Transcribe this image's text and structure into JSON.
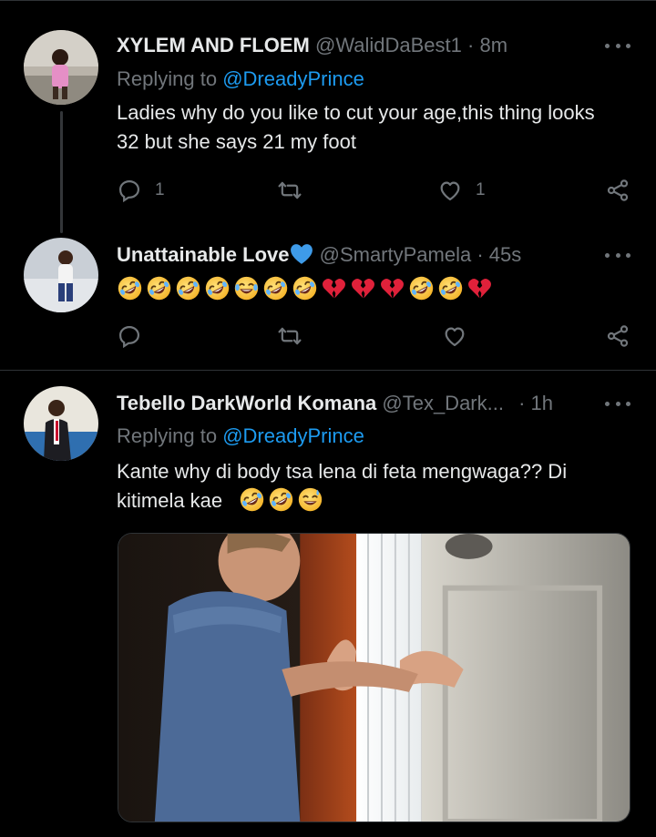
{
  "tweets": [
    {
      "display_name": "XYLEM AND FLOEM",
      "handle": "@WalidDaBest1",
      "time": "· 8m",
      "replying_prefix": "Replying to",
      "replying_to": "@DreadyPrince",
      "text": "Ladies why do you like to cut your age,this thing looks 32 but she says 21 my foot",
      "reply_count": "1",
      "retweet_count": "",
      "like_count": "1"
    },
    {
      "display_name": "Unattainable Love",
      "handle": "@SmartyPamela",
      "time": "· 45s",
      "emoji_sequence": [
        "rofl-emoji",
        "rofl-emoji",
        "rofl-emoji",
        "rofl-emoji",
        "joy-emoji",
        "rofl-emoji",
        "rofl-emoji",
        "broken-heart-emoji",
        "broken-heart-emoji",
        "broken-heart-emoji",
        "rofl-emoji",
        "rofl-emoji",
        "broken-heart-emoji"
      ]
    },
    {
      "display_name": "Tebello DarkWorld Komana",
      "handle": "@Tex_Dark...",
      "time": "· 1h",
      "replying_prefix": "Replying to",
      "replying_to": "@DreadyPrince",
      "text_line1": "Kante why di body tsa lena di feta mengwaga?? Di",
      "text_line2": "kitimela kae",
      "emoji_sequence": [
        "rofl-emoji",
        "rofl-emoji",
        "sweat-smile-emoji"
      ]
    }
  ],
  "icons": {
    "reply": "reply-icon",
    "retweet": "retweet-icon",
    "like": "heart-icon",
    "share": "share-icon",
    "more": "more-icon"
  },
  "colors": {
    "background": "#000000",
    "text": "#e7e9ea",
    "muted": "#71767b",
    "link": "#1d9bf0",
    "divider": "#2f3336"
  }
}
